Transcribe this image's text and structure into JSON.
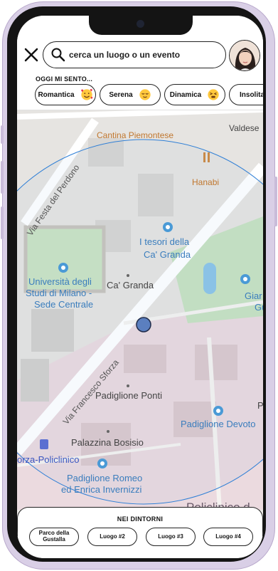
{
  "search": {
    "placeholder": "cerca un luogo o un evento"
  },
  "mood": {
    "title": "OGGI MI SENTO...",
    "chips": [
      {
        "label": "Romantica",
        "emoji": "smiling-face-with-hearts-emoji"
      },
      {
        "label": "Serena",
        "emoji": "relieved-face-emoji"
      },
      {
        "label": "Dinamica",
        "emoji": "persevering-face-emoji"
      },
      {
        "label": "Insolita",
        "emoji": ""
      }
    ]
  },
  "map": {
    "labels": {
      "cantina": "Cantina Piemontese",
      "valdese": "Valdese",
      "festa": "Via Festa del Perdono",
      "hanabi": "Hanabi",
      "tesori1": "I tesori della",
      "tesori2": "Ca' Granda",
      "uni1": "Università degli",
      "uni2": "Studi di Milano -",
      "uni3": "Sede Centrale",
      "cagranda": "Ca' Granda",
      "giar1": "Giar",
      "giar2": "Gu",
      "sforza": "Via Francesco Sforza",
      "ponti": "Padiglione Ponti",
      "devoto": "Padiglione Devoto",
      "p": "P",
      "bosisio": "Palazzina Bosisio",
      "sforzapol": "orza-Policlinico",
      "romeo1": "Padiglione Romeo",
      "romeo2": "ed Enrica Invernizzi",
      "policlinico": "Policlinico d"
    },
    "colors": {
      "radius": "#2f7fd6",
      "user_dot": "#5b7fbf",
      "park": "#c8e2c2",
      "hospital": "#ecd7de"
    }
  },
  "nearby": {
    "title": "NEI DINTORNI",
    "places": [
      "Parco della Gustalla",
      "Luogo #2",
      "Luogo #3",
      "Luogo #4"
    ]
  }
}
